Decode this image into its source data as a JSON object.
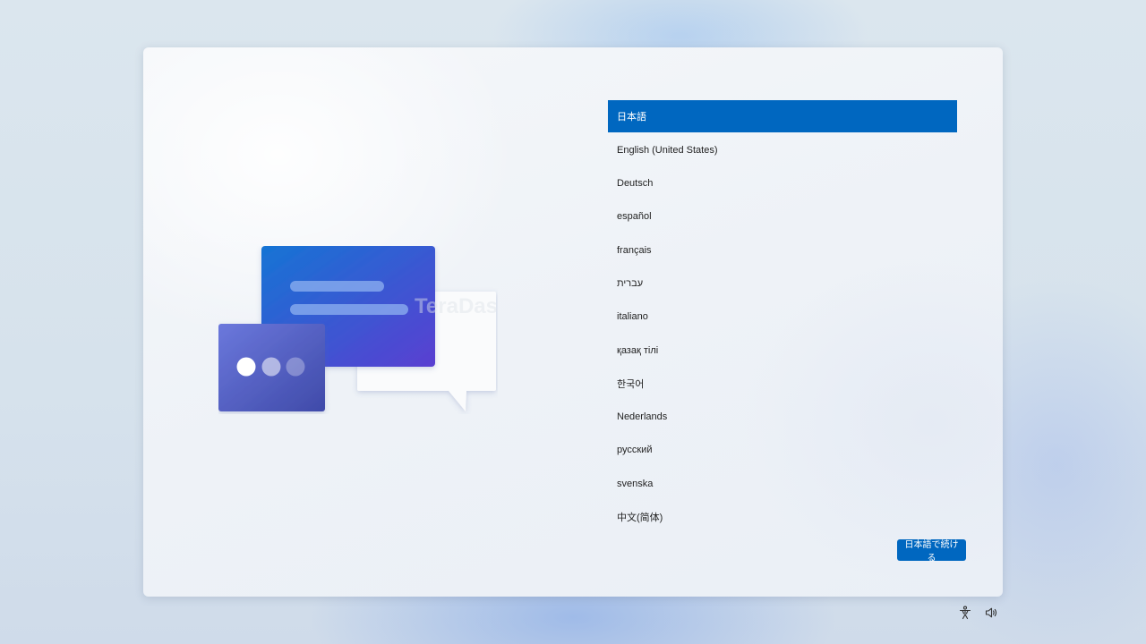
{
  "languages": [
    {
      "label": "日本語",
      "selected": true
    },
    {
      "label": "English (United States)"
    },
    {
      "label": "Deutsch"
    },
    {
      "label": "español"
    },
    {
      "label": "français"
    },
    {
      "label": "עברית"
    },
    {
      "label": "italiano"
    },
    {
      "label": "қазақ тілі"
    },
    {
      "label": "한국어"
    },
    {
      "label": "Nederlands"
    },
    {
      "label": "русский"
    },
    {
      "label": "svenska"
    },
    {
      "label": "中文(简体)"
    }
  ],
  "continue_button": {
    "label": "日本語で続ける"
  },
  "watermark": "TeraDas",
  "tray": {
    "icons": [
      "accessibility-icon",
      "volume-icon"
    ]
  },
  "colors": {
    "accent": "#0067c0",
    "text": "#1f1f1f"
  }
}
